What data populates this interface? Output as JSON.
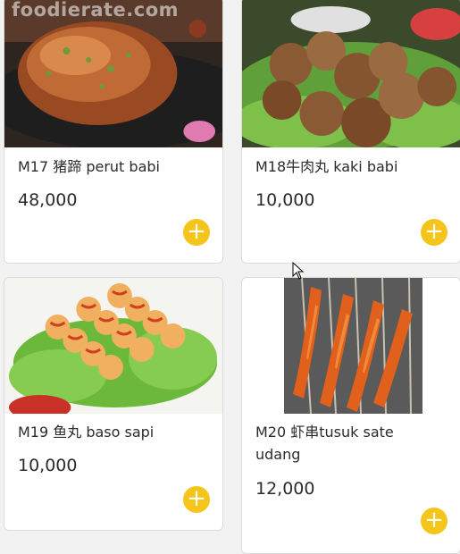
{
  "watermark": "foodierate.com",
  "accent_color": "#f6c51b",
  "products": [
    {
      "code_name": "M17 猪蹄 perut babi",
      "price": "48,000",
      "add_icon": "plus-icon"
    },
    {
      "code_name": "M18牛肉丸 kaki babi",
      "price": "10,000",
      "add_icon": "plus-icon"
    },
    {
      "code_name": "M19 鱼丸 baso sapi",
      "price": "10,000",
      "add_icon": "plus-icon"
    },
    {
      "code_name": "M20 虾串tusuk sate udang",
      "price": "12,000",
      "add_icon": "plus-icon"
    }
  ]
}
